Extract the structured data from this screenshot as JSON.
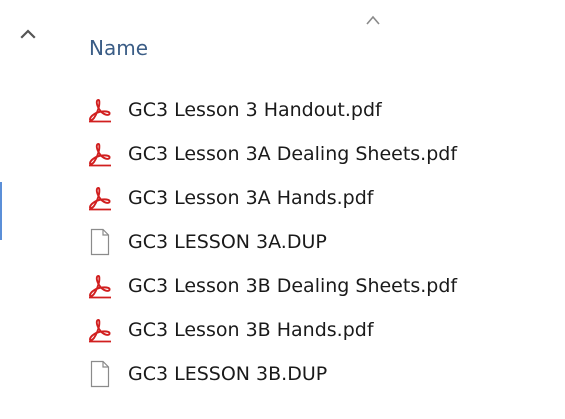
{
  "header": {
    "name_column_label": "Name"
  },
  "colors": {
    "header_text": "#3b5d86",
    "file_text": "#1a1a1a",
    "pdf_icon_red": "#d11f1f",
    "generic_icon_border": "#8b8b8b"
  },
  "files": [
    {
      "name": "GC3 Lesson 3 Handout.pdf",
      "icon": "pdf-icon"
    },
    {
      "name": "GC3 Lesson 3A Dealing Sheets.pdf",
      "icon": "pdf-icon"
    },
    {
      "name": "GC3 Lesson 3A Hands.pdf",
      "icon": "pdf-icon"
    },
    {
      "name": "GC3 LESSON 3A.DUP",
      "icon": "generic-file-icon"
    },
    {
      "name": "GC3 Lesson 3B Dealing Sheets.pdf",
      "icon": "pdf-icon"
    },
    {
      "name": "GC3 Lesson 3B Hands.pdf",
      "icon": "pdf-icon"
    },
    {
      "name": "GC3 LESSON 3B.DUP",
      "icon": "generic-file-icon"
    }
  ]
}
